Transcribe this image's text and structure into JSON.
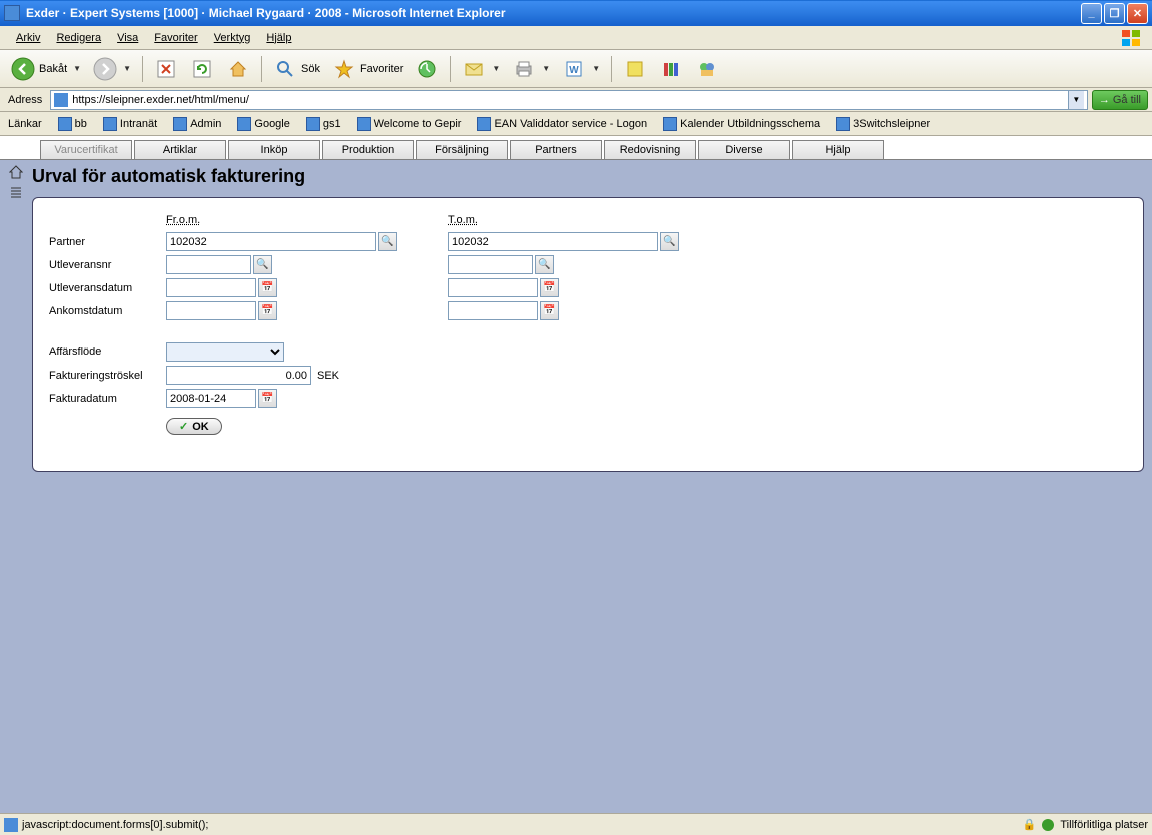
{
  "window": {
    "title": "Exder · Expert Systems [1000] · Michael Rygaard · 2008 - Microsoft Internet Explorer"
  },
  "menu": {
    "items": [
      "Arkiv",
      "Redigera",
      "Visa",
      "Favoriter",
      "Verktyg",
      "Hjälp"
    ]
  },
  "toolbar": {
    "back": "Bakåt",
    "search": "Sök",
    "favorites": "Favoriter"
  },
  "address": {
    "label": "Adress",
    "url": "https://sleipner.exder.net/html/menu/",
    "go": "Gå till"
  },
  "links": {
    "label": "Länkar",
    "items": [
      "bb",
      "Intranät",
      "Admin",
      "Google",
      "gs1",
      "Welcome to Gepir",
      "EAN Validdator service - Logon",
      "Kalender Utbildningsschema",
      "3Switchsleipner"
    ]
  },
  "apptabs": [
    "Varucertifikat",
    "Artiklar",
    "Inköp",
    "Produktion",
    "Försäljning",
    "Partners",
    "Redovisning",
    "Diverse",
    "Hjälp"
  ],
  "page": {
    "title": "Urval för automatisk fakturering",
    "col_from": "Fr.o.m.",
    "col_to": "T.o.m.",
    "labels": {
      "partner": "Partner",
      "utleveransnr": "Utleveransnr",
      "utleveransdatum": "Utleveransdatum",
      "ankomstdatum": "Ankomstdatum",
      "affarsflode": "Affärsflöde",
      "faktureringstroskel": "Faktureringströskel",
      "fakturadatum": "Fakturadatum"
    },
    "values": {
      "partner_from": "102032",
      "partner_to": "102032",
      "utleveransnr_from": "",
      "utleveransnr_to": "",
      "utleveransdatum_from": "",
      "utleveransdatum_to": "",
      "ankomstdatum_from": "",
      "ankomstdatum_to": "",
      "affarsflode": "",
      "faktureringstroskel": "0.00",
      "fakturadatum": "2008-01-24"
    },
    "currency": "SEK",
    "ok_label": "OK"
  },
  "status": {
    "text": "javascript:document.forms[0].submit();",
    "zone": "Tillförlitliga platser"
  }
}
